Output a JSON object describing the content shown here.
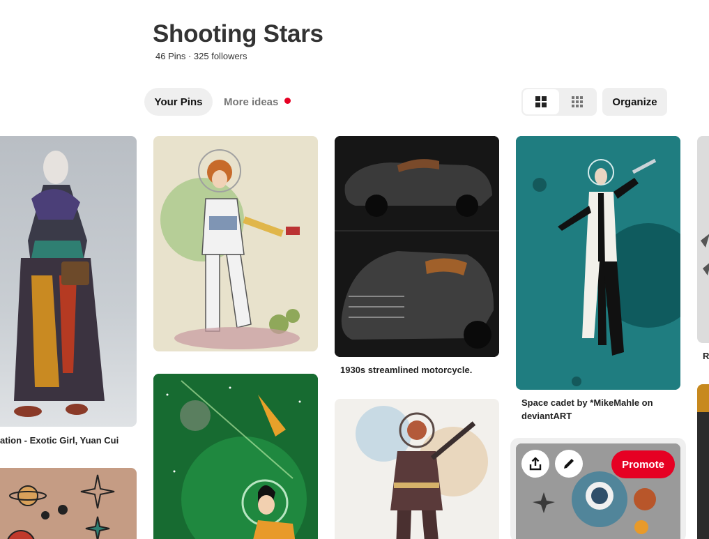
{
  "board": {
    "title": "Shooting Stars",
    "meta": "46 Pins · 325 followers"
  },
  "tabs": {
    "your_pins": "Your Pins",
    "more_ideas": "More ideas"
  },
  "toolbar": {
    "organize": "Organize",
    "view_default_icon": "grid-large-icon",
    "view_compact_icon": "grid-compact-icon"
  },
  "pins": {
    "exotic_girl": {
      "caption": "ation - Exotic Girl, Yuan Cui"
    },
    "motorcycle": {
      "caption": "1930s streamlined motorcycle."
    },
    "space_cadet": {
      "caption_line1": "Space cadet by *MikeMahle on",
      "caption_line2": "deviantART"
    },
    "partial_right": {
      "caption": "R"
    }
  },
  "hover_actions": {
    "promote": "Promote",
    "share_icon": "share-icon",
    "edit_icon": "pencil-icon"
  },
  "colors": {
    "accent_red": "#e60023",
    "button_gray": "#efefef"
  }
}
